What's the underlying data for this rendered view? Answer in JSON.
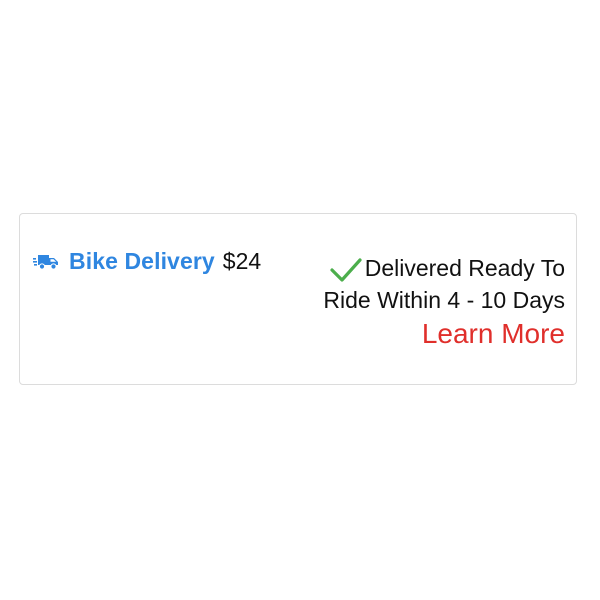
{
  "delivery": {
    "icon": "delivery-truck-icon",
    "title": "Bike Delivery",
    "price": "$24",
    "check_icon": "checkmark-icon",
    "info": "Delivered Ready To Ride Within 4 - 10 Days",
    "link_label": "Learn More",
    "colors": {
      "title": "#2f86e0",
      "check": "#4cae4c",
      "link": "#e02f2b"
    }
  }
}
